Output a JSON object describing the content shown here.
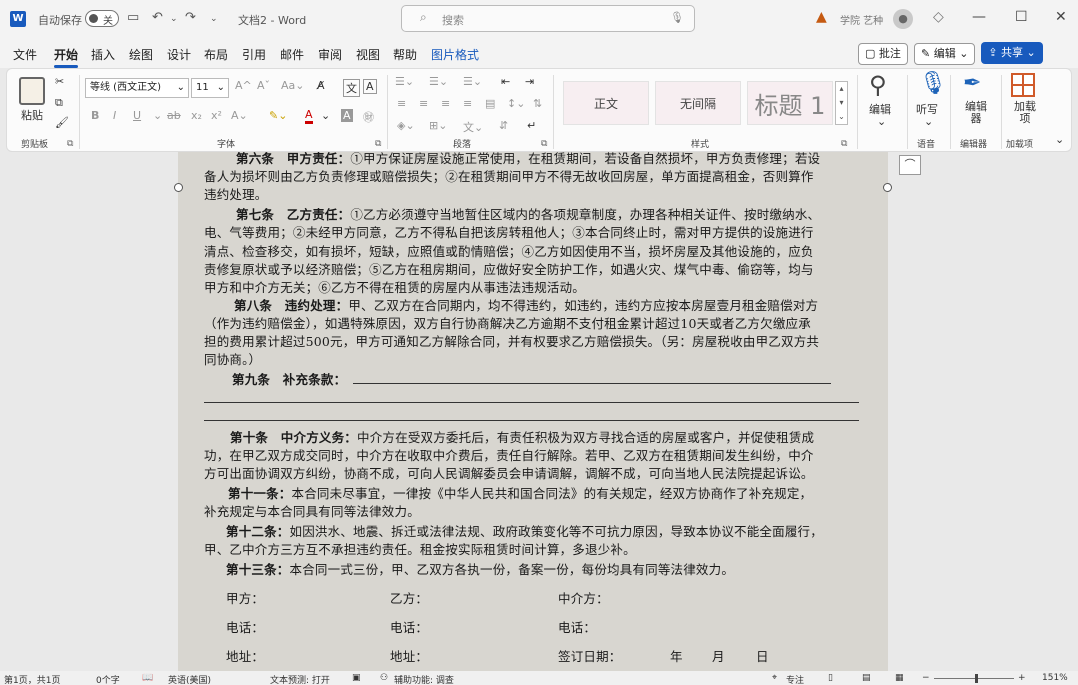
{
  "titlebar": {
    "autosave_label": "自动保存",
    "autosave_state": "关",
    "doc_title": "文档2 - Word",
    "search_placeholder": "搜索",
    "user_name": "学院 艺种"
  },
  "tabs": [
    "文件",
    "开始",
    "插入",
    "绘图",
    "设计",
    "布局",
    "引用",
    "邮件",
    "审阅",
    "视图",
    "帮助",
    "图片格式"
  ],
  "active_tab": "开始",
  "right_actions": {
    "comments": "批注",
    "editing": "编辑",
    "share": "共享"
  },
  "ribbon": {
    "clipboard": {
      "paste": "粘贴",
      "group": "剪贴板"
    },
    "font": {
      "font_name": "等线 (西文正文)",
      "font_size": "11",
      "aa": "Aa",
      "group": "字体"
    },
    "paragraph": {
      "group": "段落"
    },
    "styles": {
      "items": [
        "正文",
        "无间隔",
        "标题 1"
      ],
      "group": "样式"
    },
    "editing": {
      "label": "编辑"
    },
    "voice": {
      "label": "听写",
      "group": "语音"
    },
    "editor": {
      "label": "编辑器",
      "group": "编辑器"
    },
    "addins": {
      "label": "加载项",
      "group": "加载项"
    }
  },
  "document_lines": [
    {
      "bold": "第六条　甲方责任：",
      "text": "①甲方保证房屋设施正常使用，在租赁期间，若设备自然损坏，甲方负责修理；若设"
    },
    {
      "bold": "",
      "text": "备人为损坏则由乙方负责修理或赔偿损失；②在租赁期间甲方不得无故收回房屋，单方面提高租金，否则算作"
    },
    {
      "bold": "",
      "text": "违约处理。"
    },
    {
      "bold": "第七条　乙方责任：",
      "text": "①乙方必须遵守当地暂住区域内的各项规章制度，办理各种相关证件、按时缴纳水、"
    },
    {
      "bold": "",
      "text": "电、气等费用；②未经甲方同意，乙方不得私自把该房转租他人；③本合同终止时，需对甲方提供的设施进行"
    },
    {
      "bold": "",
      "text": "清点、检查移交，如有损坏，短缺，应照值或酌情赔偿；④乙方如因使用不当，损坏房屋及其他设施的，应负"
    },
    {
      "bold": "",
      "text": "责修复原状或予以经济赔偿；⑤乙方在租房期间，应做好安全防护工作，如遇火灾、煤气中毒、偷窃等，均与"
    },
    {
      "bold": "",
      "text": "甲方和中介方无关；⑥乙方不得在租赁的房屋内从事违法违规活动。"
    },
    {
      "bold": "第八条　违约处理：",
      "text": "甲、乙双方在合同期内，均不得违约，如违约，违约方应按本房屋壹月租金赔偿对方"
    },
    {
      "bold": "",
      "text": "（作为违约赔偿金），如遇特殊原因，双方自行协商解决乙方逾期不支付租金累计超过10天或者乙方欠缴应承"
    },
    {
      "bold": "",
      "text": "担的费用累计超过500元，甲方可通知乙方解除合同，并有权要求乙方赔偿损失。（另：房屋税收由甲乙双方共"
    },
    {
      "bold": "",
      "text": "同协商。）"
    },
    {
      "bold": "第九条　补充条款：",
      "text": ""
    },
    {
      "bold": "第十条　中介方义务：",
      "text": "中介方在受双方委托后，有责任积极为双方寻找合适的房屋或客户，并促使租赁成"
    },
    {
      "bold": "",
      "text": "功，在甲乙双方成交同时，中介方在收取中介费后，责任自行解除。若甲、乙双方在租赁期间发生纠纷，中介"
    },
    {
      "bold": "",
      "text": "方可出面协调双方纠纷，协商不成，可向人民调解委员会申请调解，调解不成，可向当地人民法院提起诉讼。"
    },
    {
      "bold": "第十一条：",
      "text": "本合同未尽事宜，一律按《中华人民共和国合同法》的有关规定，经双方协商作了补充规定，"
    },
    {
      "bold": "",
      "text": "补充规定与本合同具有同等法律效力。"
    },
    {
      "bold": "第十二条：",
      "text": "如因洪水、地震、拆迁或法律法规、政府政策变化等不可抗力原因，导致本协议不能全面履行，"
    },
    {
      "bold": "",
      "text": "甲、乙中介方三方互不承担违约责任。租金按实际租赁时间计算，多退少补。"
    },
    {
      "bold": "第十三条：",
      "text": "本合同一式三份，甲、乙双方各执一份，备案一份，每份均具有同等法律效力。"
    }
  ],
  "signature": {
    "party_a": "甲方：",
    "party_b": "乙方：",
    "agent": "中介方：",
    "phone_a": "电话：",
    "phone_b": "电话：",
    "phone_c": "电话：",
    "addr_a": "地址：",
    "addr_b": "地址：",
    "sign_date": "签订日期：",
    "year": "年",
    "month": "月",
    "day": "日"
  },
  "statusbar": {
    "page": "第1页，共1页",
    "words": "0个字",
    "language": "英语(美国)",
    "predict": "文本预测: 打开",
    "accessibility": "辅助功能: 调查",
    "focus": "专注",
    "zoom": "151%"
  }
}
